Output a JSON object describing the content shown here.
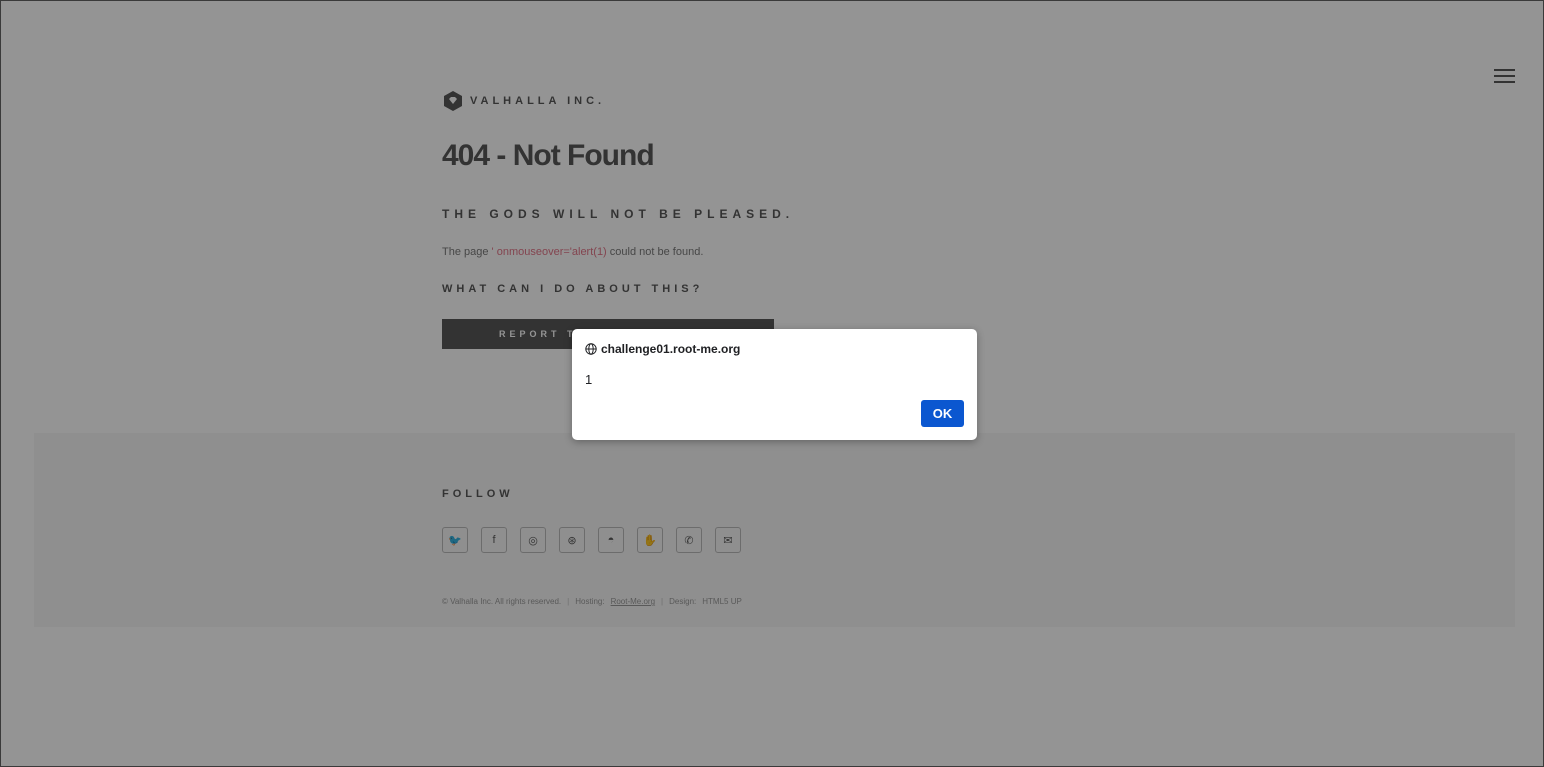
{
  "brand": {
    "name": "VALHALLA INC.",
    "logo_icon": "diamond-shield-icon"
  },
  "page": {
    "title": "404 - Not Found",
    "subtitle": "THE GODS WILL NOT BE PLEASED.",
    "message_prefix": "The page",
    "message_payload": "' onmouseover='alert(1)",
    "message_suffix": "could not be found.",
    "question": "WHAT CAN I DO ABOUT THIS?",
    "report_button": "REPORT TO"
  },
  "nav": {
    "menu_icon": "hamburger-menu-icon"
  },
  "footer": {
    "follow_heading": "FOLLOW",
    "social": [
      {
        "name": "twitter-icon",
        "glyph": "🐦"
      },
      {
        "name": "facebook-icon",
        "glyph": "f"
      },
      {
        "name": "instagram-icon",
        "glyph": "◎"
      },
      {
        "name": "dribbble-icon",
        "glyph": "⊛"
      },
      {
        "name": "github-icon",
        "glyph": "◓"
      },
      {
        "name": "hand-icon",
        "glyph": "✋"
      },
      {
        "name": "phone-icon",
        "glyph": "✆"
      },
      {
        "name": "envelope-icon",
        "glyph": "✉"
      }
    ],
    "copyright": "© Valhalla Inc. All rights reserved.",
    "hosting_label": "Hosting:",
    "hosting_link": "Root-Me.org",
    "design_label": "Design:",
    "design_link": "HTML5 UP"
  },
  "alert": {
    "origin": "challenge01.root-me.org",
    "message": "1",
    "ok_label": "OK"
  },
  "colors": {
    "text": "#585858",
    "payload": "#e27689",
    "ok_button": "#0b57d0"
  }
}
